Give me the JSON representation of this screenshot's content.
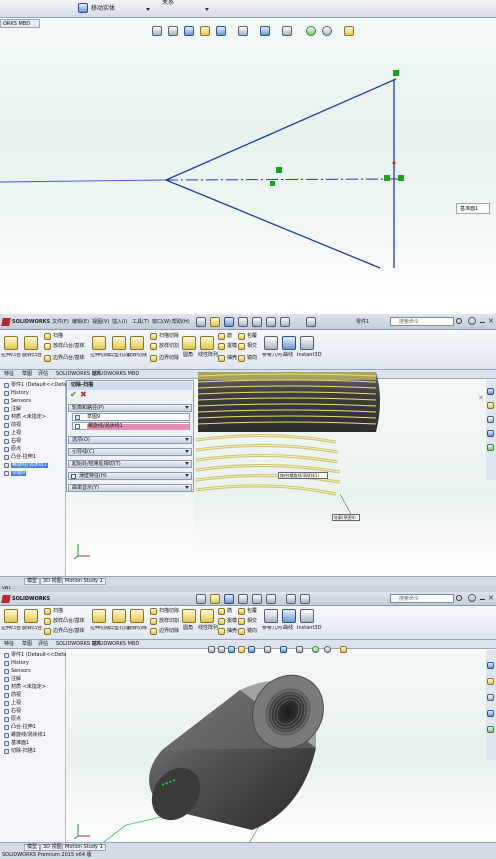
{
  "panel1": {
    "tab_label": "ORKS MBD",
    "move_entity_label": "移动实体",
    "rel_label": "关系",
    "plane_tooltip": "基准面1"
  },
  "panel2": {
    "app_logo": "SOLIDWORKS",
    "menu": [
      "文件(F)",
      "编辑(E)",
      "视图(V)",
      "插入(I)",
      "工具(T)",
      "窗口(W)",
      "帮助(H)"
    ],
    "search_placeholder": "搜索命令",
    "ribbon": {
      "extruded_boss": "拉伸凸台/基体",
      "revolved_boss": "旋转凸台/基体",
      "swept_boss": "扫描",
      "lofted_boss": "放样凸台/基体",
      "boundary_boss": "边界凸台/基体",
      "extruded_cut": "拉伸切除",
      "hole_wizard": "异型孔向导",
      "revolved_cut": "旋转切除",
      "swept_cut": "扫描切除",
      "lofted_cut": "放样切割",
      "boundary_cut": "边界切除",
      "fillet": "圆角",
      "linear_pattern": "线性阵列",
      "rib": "筋",
      "draft": "拔模",
      "shell": "抽壳",
      "wrap": "包覆",
      "intersect": "相交",
      "mirror": "镜向",
      "ref_geom": "参考几何体",
      "curves": "曲线",
      "instant3d": "Instant3D"
    },
    "cmd_tabs": [
      "特征",
      "草图",
      "评估",
      "SOLIDWORKS 插件",
      "SOLIDWORKS MBD"
    ],
    "tree_items": [
      "零件1 (Default<<Default>_P",
      "History",
      "Sensors",
      "注解",
      "材质 <未指定>",
      "前视",
      "上视",
      "右视",
      "原点",
      "凸台-拉伸1",
      "螺旋线/涡状线1",
      "草图9"
    ],
    "pm": {
      "title": "切除-扫描",
      "section_profile": "轮廓和路径(P)",
      "profile_value": "草图9",
      "path_value": "螺旋线/涡状线1",
      "options": "选项(O)",
      "guide_curves": "引导线(C)",
      "start_end": "起始处/结束处相切(T)",
      "thin": "薄壁特征(H)",
      "curvature": "曲率显示(Y)"
    },
    "callout_path": "路径(螺旋线/涡状线1)",
    "callout_profile": "轮廓(草图9)",
    "status_tabs": [
      "模型",
      "3D 视图",
      "Motion Study 1"
    ]
  },
  "panel3": {
    "app_logo": "SOLIDWORKS",
    "tab_label_top": "SW1",
    "cmd_tabs": [
      "特征",
      "草图",
      "评估",
      "SOLIDWORKS 插件",
      "SOLIDWORKS MBD"
    ],
    "tree_items": [
      "零件1 (Default<<Default>_P",
      "History",
      "Sensors",
      "注解",
      "材质 <未指定>",
      "前视",
      "上视",
      "右视",
      "原点",
      "凸台-拉伸1",
      "螺旋线/涡状线1",
      "基准面1",
      "切除-扫描1"
    ],
    "status_tabs": [
      "模型",
      "3D 视图",
      "Motion Study 1"
    ],
    "status_text": "SOLIDWORKS Premium 2015 x64 版"
  },
  "colors": {
    "sketch_line": "#1f3aa8",
    "endpoint": "#1aa31a",
    "accent_blue": "#2d6fd8",
    "selection": "#3d7de0"
  }
}
